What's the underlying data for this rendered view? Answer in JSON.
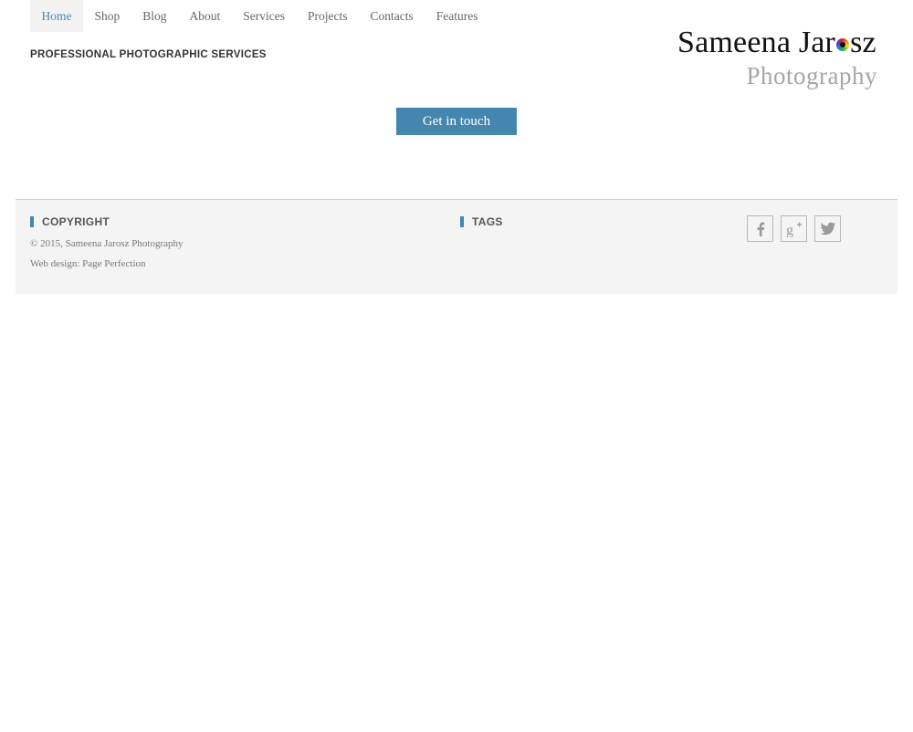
{
  "nav": {
    "items": [
      {
        "label": "Home",
        "active": true
      },
      {
        "label": "Shop"
      },
      {
        "label": "Blog"
      },
      {
        "label": "About"
      },
      {
        "label": "Services"
      },
      {
        "label": "Projects"
      },
      {
        "label": "Contacts"
      },
      {
        "label": "Features"
      }
    ]
  },
  "header": {
    "tagline": "PROFESSIONAL PHOTOGRAPHIC SERVICES",
    "logo": {
      "name_first": "Sameena J",
      "name_ar": "ar",
      "name_sz": "sz",
      "subtitle": "Photography"
    }
  },
  "cta": {
    "label": "Get in touch"
  },
  "footer": {
    "copyright_heading": "COPYRIGHT",
    "copyright_text": "© 2015, Sameena Jarosz Photography",
    "webdesign_text": "Web design: Page Perfection",
    "tags_heading": "TAGS",
    "social": [
      "facebook-icon",
      "google-plus-icon",
      "twitter-icon"
    ]
  },
  "colors": {
    "accent": "#4486ae",
    "nav_active_bg": "#f2f2f2",
    "footer_bg": "#f4f4f4"
  }
}
